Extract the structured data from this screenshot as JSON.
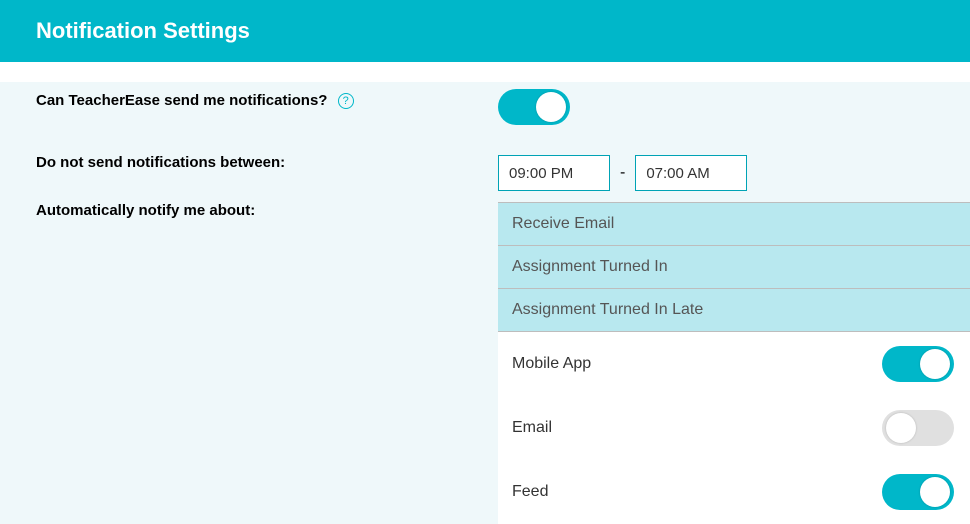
{
  "header": {
    "title": "Notification Settings"
  },
  "labels": {
    "can_send": "Can TeacherEase send me notifications?",
    "do_not_send": "Do not send notifications between:",
    "auto_notify": "Automatically notify me about:",
    "dash": "-"
  },
  "master_toggle": {
    "on": true
  },
  "quiet_hours": {
    "start": "09:00 PM",
    "end": "07:00 AM"
  },
  "categories": [
    {
      "label": "Receive Email"
    },
    {
      "label": "Assignment Turned In"
    },
    {
      "label": "Assignment Turned In Late"
    }
  ],
  "channels": [
    {
      "label": "Mobile App",
      "on": true
    },
    {
      "label": "Email",
      "on": false
    },
    {
      "label": "Feed",
      "on": true
    }
  ],
  "icons": {
    "help": "?"
  }
}
